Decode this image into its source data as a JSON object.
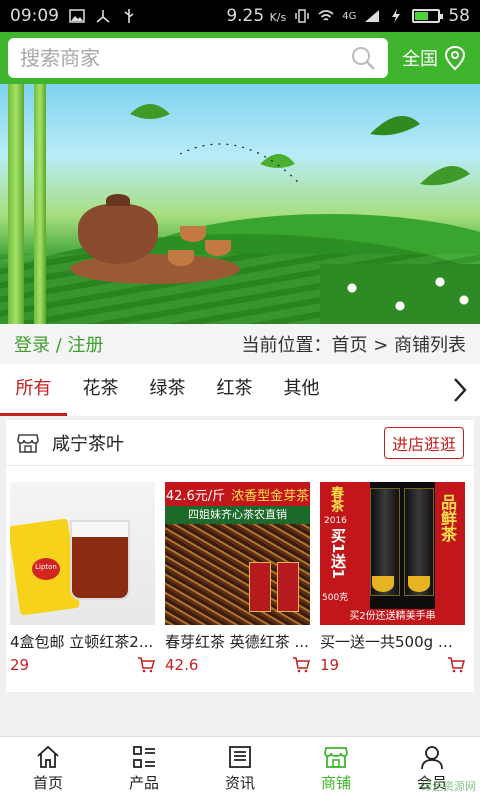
{
  "status_bar": {
    "time": "09:09",
    "speed": "9.25",
    "speed_unit": "K/s",
    "network": "4G",
    "battery": "58",
    "battery_level": 0.58
  },
  "header": {
    "search_placeholder": "搜索商家",
    "region_label": "全国"
  },
  "login_bar": {
    "login_label": "登录 / 注册",
    "breadcrumb": "当前位置：首页 > 商铺列表"
  },
  "tabs": [
    {
      "label": "所有",
      "active": true
    },
    {
      "label": "花茶",
      "active": false
    },
    {
      "label": "绿茶",
      "active": false
    },
    {
      "label": "红茶",
      "active": false
    },
    {
      "label": "其他",
      "active": false
    }
  ],
  "shop": {
    "name": "咸宁茶叶",
    "visit_label": "进店逛逛",
    "products": [
      {
        "title": "4盒包邮 立顿红茶2...",
        "price": "29",
        "image_text": "Lipton"
      },
      {
        "title": "春芽红茶 英德红茶 ...",
        "price": "42.6",
        "image_price": "42.6元/斤",
        "image_tag": "浓香型金芽茶",
        "image_band": "四姐妹齐心茶农直销"
      },
      {
        "title": "买一送一共500g 特...",
        "price": "19",
        "image_left": "春茶",
        "image_year": "2016",
        "image_promo": "买1送1",
        "image_weight": "500克",
        "image_right": "品鲜茶",
        "image_strip": "买2份还送精美手串"
      }
    ]
  },
  "bottom_nav": [
    {
      "label": "首页",
      "icon": "home-icon",
      "active": false
    },
    {
      "label": "产品",
      "icon": "list-icon",
      "active": false
    },
    {
      "label": "资讯",
      "icon": "news-icon",
      "active": false
    },
    {
      "label": "商铺",
      "icon": "store-icon",
      "active": true
    },
    {
      "label": "会员",
      "icon": "user-icon",
      "active": false
    }
  ],
  "watermark": "绿色资源网",
  "colors": {
    "brand_green": "#3fb52e",
    "accent_red": "#c21f1f"
  }
}
